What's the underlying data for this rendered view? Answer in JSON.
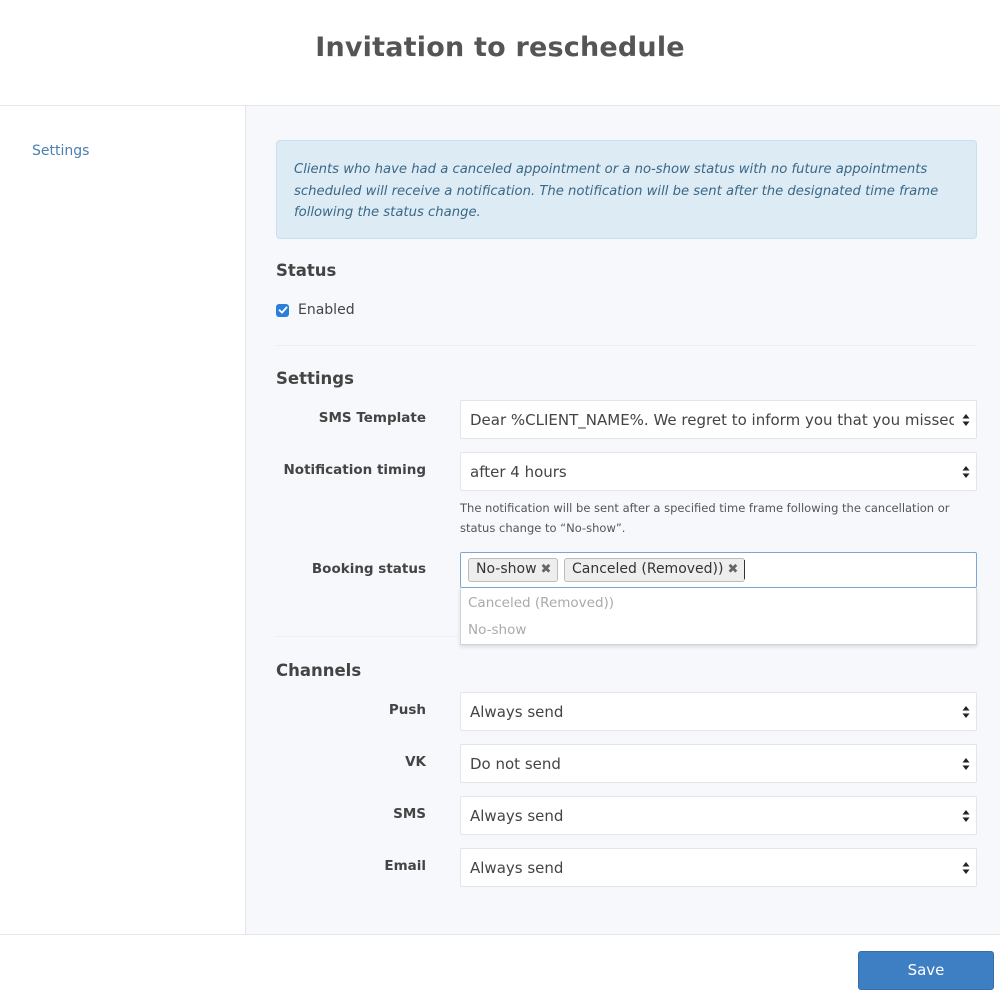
{
  "header": {
    "title": "Invitation to reschedule"
  },
  "sidebar": {
    "items": [
      {
        "label": "Settings"
      }
    ]
  },
  "info": {
    "lines": [
      "Clients who have had a canceled appointment or a no-show status with no future appointments",
      "scheduled will receive a notification. The notification will be sent after the designated time frame",
      "following the status change."
    ]
  },
  "status": {
    "title": "Status",
    "enabled_label": "Enabled",
    "enabled": true
  },
  "settings": {
    "title": "Settings",
    "sms_template": {
      "label": "SMS Template",
      "value": "Dear %CLIENT_NAME%. We regret to inform you that you missed your"
    },
    "notification_timing": {
      "label": "Notification timing",
      "value": "after 4 hours",
      "help_lines": [
        "The notification will be sent after a specified time frame following the cancellation or",
        "status change to “No-show”."
      ]
    },
    "booking_status": {
      "label": "Booking status",
      "tags": [
        "No-show",
        "Canceled (Removed))"
      ],
      "remove_glyph": "✖",
      "dropdown_options": [
        "Canceled (Removed))",
        "No-show"
      ]
    }
  },
  "channels": {
    "title": "Channels",
    "items": [
      {
        "label": "Push",
        "value": "Always send"
      },
      {
        "label": "VK",
        "value": "Do not send"
      },
      {
        "label": "SMS",
        "value": "Always send"
      },
      {
        "label": "Email",
        "value": "Always send"
      }
    ]
  },
  "footer": {
    "save_label": "Save"
  },
  "colors": {
    "accent": "#3d7fc2",
    "info_background": "#ddebf5",
    "info_text": "#3a6886",
    "sidebar_link": "#4a7fb0"
  },
  "icons": {
    "select_arrows": "updown-arrows-icon",
    "checkbox": "checkmark-icon",
    "tag_remove": "remove-tag-icon"
  }
}
